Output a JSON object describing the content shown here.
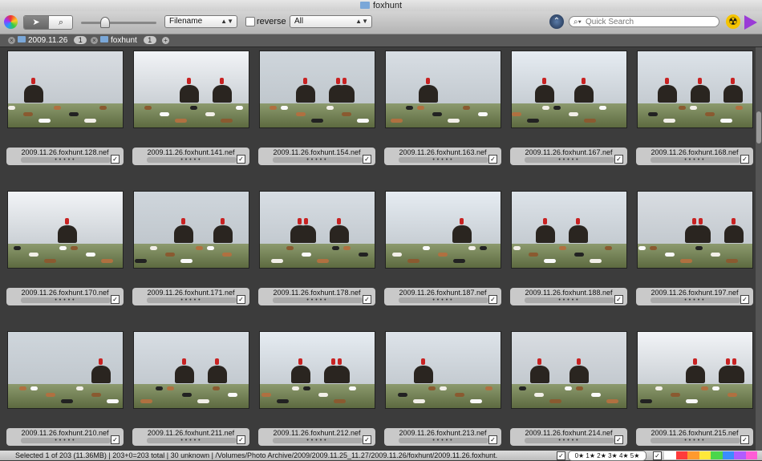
{
  "window": {
    "title": "foxhunt"
  },
  "toolbar": {
    "sort_field": "Filename",
    "reverse_label": "reverse",
    "filter_value": "All",
    "search_placeholder": "Quick Search"
  },
  "tabs": [
    {
      "label": "2009.11.26",
      "count": "1"
    },
    {
      "label": "foxhunt",
      "count": "1"
    }
  ],
  "thumbnails": [
    {
      "filename": "2009.11.26.foxhunt.128.nef"
    },
    {
      "filename": "2009.11.26.foxhunt.141.nef"
    },
    {
      "filename": "2009.11.26.foxhunt.154.nef"
    },
    {
      "filename": "2009.11.26.foxhunt.163.nef"
    },
    {
      "filename": "2009.11.26.foxhunt.167.nef"
    },
    {
      "filename": "2009.11.26.foxhunt.168.nef"
    },
    {
      "filename": "2009.11.26.foxhunt.170.nef"
    },
    {
      "filename": "2009.11.26.foxhunt.171.nef"
    },
    {
      "filename": "2009.11.26.foxhunt.178.nef"
    },
    {
      "filename": "2009.11.26.foxhunt.187.nef"
    },
    {
      "filename": "2009.11.26.foxhunt.188.nef"
    },
    {
      "filename": "2009.11.26.foxhunt.197.nef"
    },
    {
      "filename": "2009.11.26.foxhunt.210.nef"
    },
    {
      "filename": "2009.11.26.foxhunt.211.nef"
    },
    {
      "filename": "2009.11.26.foxhunt.212.nef"
    },
    {
      "filename": "2009.11.26.foxhunt.213.nef"
    },
    {
      "filename": "2009.11.26.foxhunt.214.nef"
    },
    {
      "filename": "2009.11.26.foxhunt.215.nef"
    }
  ],
  "status": {
    "text": "Selected 1 of 203 (11.36MB) | 203+0=203 total | 30 unknown | /Volumes/Photo Archive/2009/2009.11.25_11.27/2009.11.26/foxhunt/2009.11.26.foxhunt.",
    "rating_filter": "0★ 1★ 2★ 3★ 4★ 5★"
  },
  "colors": {
    "label_colors": [
      "#ffffff",
      "#ff3b3b",
      "#ff9a2e",
      "#ffe83a",
      "#4bd64b",
      "#3b8cff",
      "#b05cff",
      "#ff5cd6"
    ]
  }
}
